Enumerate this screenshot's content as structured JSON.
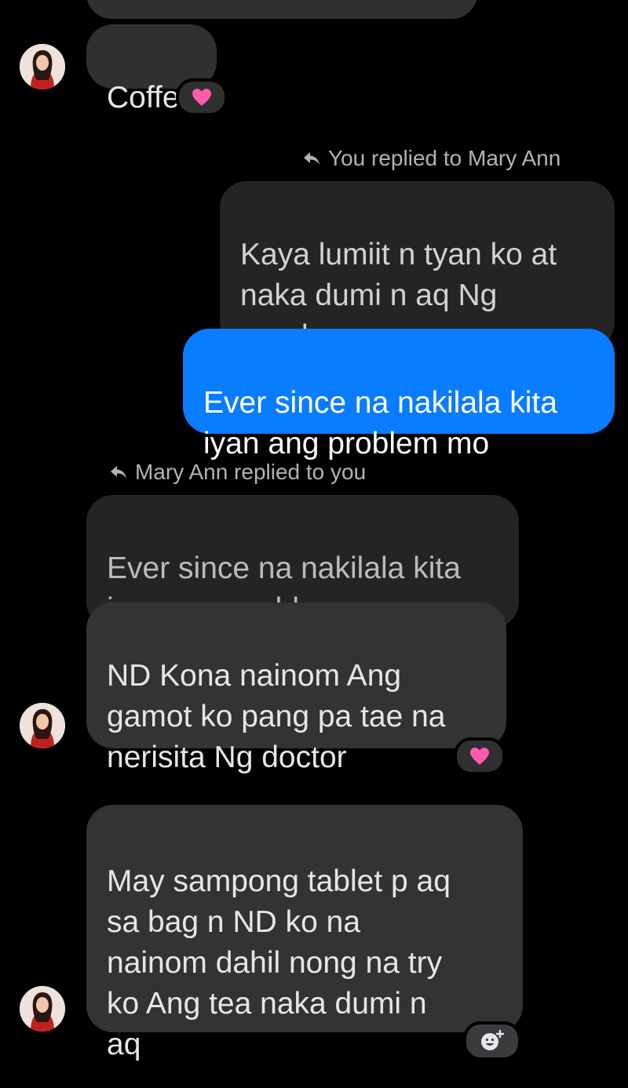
{
  "contact": {
    "name": "Mary Ann"
  },
  "messages": {
    "m1": {
      "text": "Coffee",
      "reaction": "heart"
    },
    "m2_note": "You replied to Mary Ann",
    "m2_quoted": "Kaya lumiit n tyan ko at\nnaka dumi n aq Ng\nregular",
    "m2": {
      "text": "Ever since na nakilala kita\niyan ang problem mo"
    },
    "m3_note": "Mary Ann replied to you",
    "m3_quoted": "Ever since na nakilala kita\niyan ang problem mo",
    "m3": {
      "text": "ND Kona nainom Ang\ngamot ko pang pa tae na\nnerisita Ng doctor",
      "reaction": "heart"
    },
    "m4": {
      "text": "May sampong  tablet p aq\nsa bag n ND ko na\nnainom dahil  nong na try\nko Ang tea naka dumi n\naq",
      "reaction": "add-reaction"
    }
  },
  "colors": {
    "background": "#000000",
    "incoming_bubble": "#303030",
    "outgoing_bubble": "#0a7cff",
    "heart": "#ff5cae"
  },
  "icons": [
    "reply-arrow-icon",
    "heart-icon",
    "add-reaction-icon",
    "avatar"
  ]
}
